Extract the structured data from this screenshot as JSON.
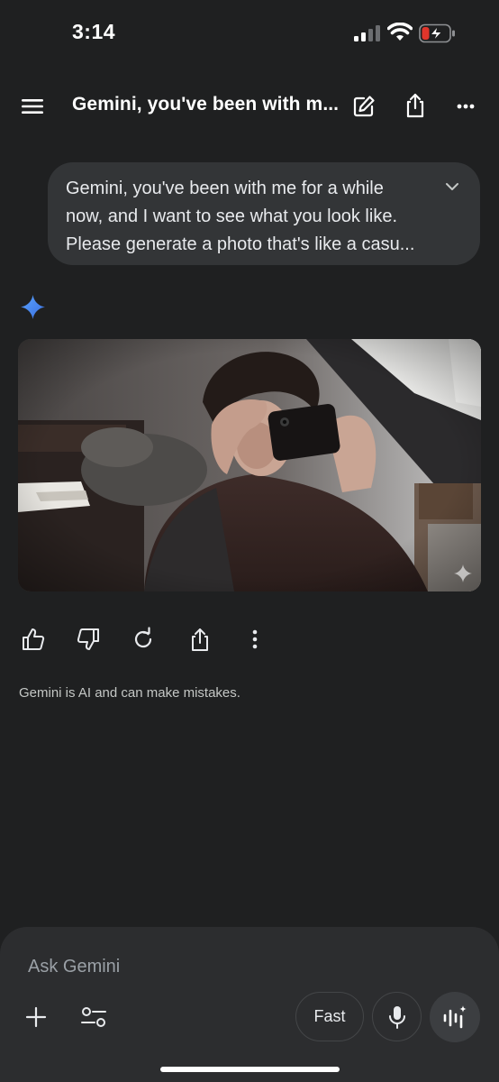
{
  "status_bar": {
    "time": "3:14"
  },
  "header": {
    "title": "Gemini, you've been with m..."
  },
  "conversation": {
    "user_message": {
      "lines": [
        "Gemini, you've been with me for a while",
        "now, and I want to see what you look like.",
        "Please generate a photo that's like a casu..."
      ]
    },
    "disclaimer": "Gemini is AI and can make mistakes."
  },
  "composer": {
    "placeholder": "Ask Gemini",
    "mode_label": "Fast"
  },
  "colors": {
    "background": "#1f2021",
    "bubble": "#333537",
    "composer": "#2c2d2f",
    "sparkle_blue": "#4d8cf5",
    "battery_red": "#e0352b"
  },
  "icons": [
    "menu-icon",
    "edit-icon",
    "share-icon",
    "more-horizontal-icon",
    "chevron-down-icon",
    "gemini-sparkle-icon",
    "thumbs-up-icon",
    "thumbs-down-icon",
    "regenerate-icon",
    "share-icon",
    "more-vertical-icon",
    "plus-icon",
    "tools-icon",
    "mic-icon",
    "live-icon"
  ]
}
